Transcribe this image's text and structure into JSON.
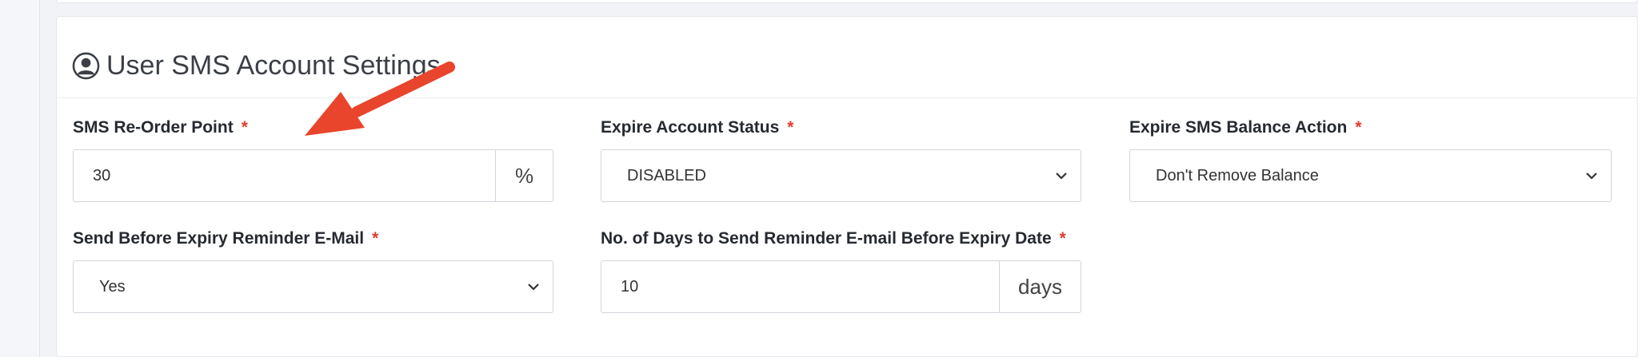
{
  "section": {
    "title": "User SMS Account Settings",
    "icon": "user-circle-icon"
  },
  "fields": {
    "reorder_point": {
      "label": "SMS Re-Order Point",
      "required_mark": "*",
      "value": "30",
      "addon": "%"
    },
    "expire_status": {
      "label": "Expire Account Status",
      "required_mark": "*",
      "selected": "DISABLED"
    },
    "expire_balance_action": {
      "label": "Expire SMS Balance Action",
      "required_mark": "*",
      "selected": "Don't Remove Balance"
    },
    "reminder_email": {
      "label": "Send Before Expiry Reminder E-Mail",
      "required_mark": "*",
      "selected": "Yes"
    },
    "reminder_days": {
      "label": "No. of Days to Send Reminder E-mail Before Expiry Date",
      "required_mark": "*",
      "value": "10",
      "addon": "days"
    }
  },
  "colors": {
    "required": "#e23b2f",
    "arrow": "#e8452c"
  }
}
